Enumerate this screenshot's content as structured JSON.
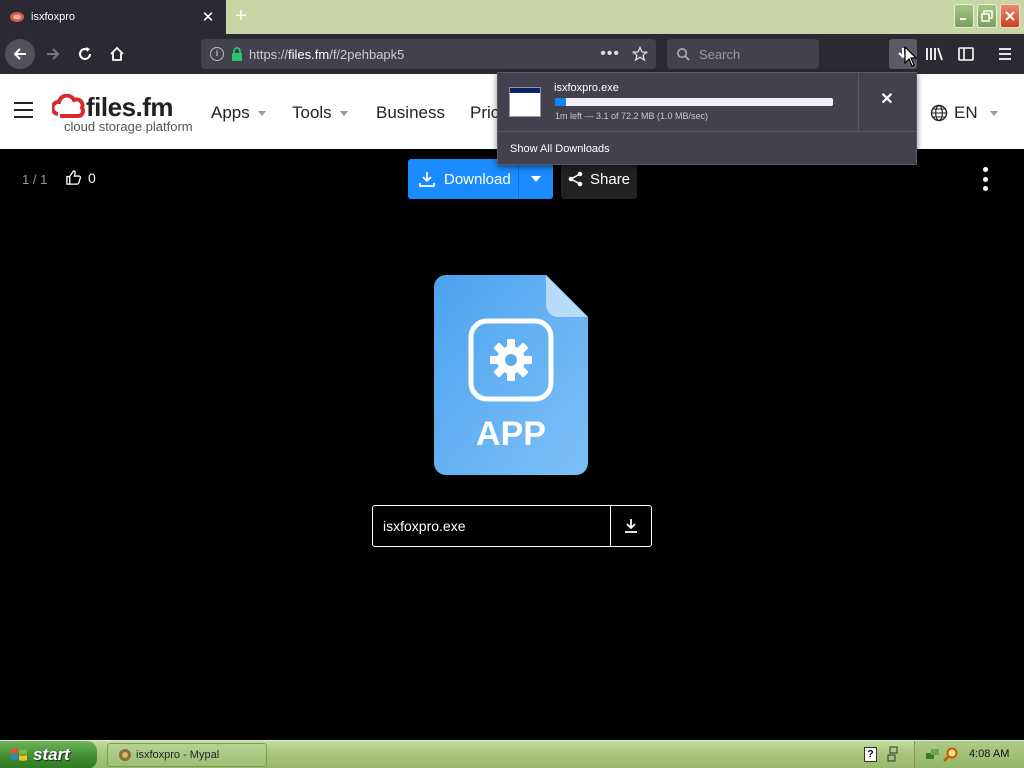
{
  "browser": {
    "tab_title": "isxfoxpro",
    "url_prefix": "https://",
    "url_domain": "files.fm",
    "url_path": "/f/2pehbapk5",
    "search_placeholder": "Search"
  },
  "site": {
    "logo_name": "files.fm",
    "logo_tagline": "cloud storage platform",
    "menu": [
      "Apps",
      "Tools",
      "Business",
      "Pric"
    ],
    "language": "EN"
  },
  "download_panel": {
    "filename": "isxfoxpro.exe",
    "progress": 0.04,
    "status": "1m left — 3.1 of 72.2 MB (1.0 MB/sec)",
    "show_all": "Show All Downloads"
  },
  "file_page": {
    "counter": "1 / 1",
    "likes": "0",
    "download_label": "Download",
    "share_label": "Share",
    "app_icon_text": "APP",
    "filename": "isxfoxpro.exe",
    "accent": "#1a8cff"
  },
  "taskbar": {
    "start_label": "start",
    "task_label": "isxfoxpro - Mypal",
    "clock": "4:08 AM"
  }
}
